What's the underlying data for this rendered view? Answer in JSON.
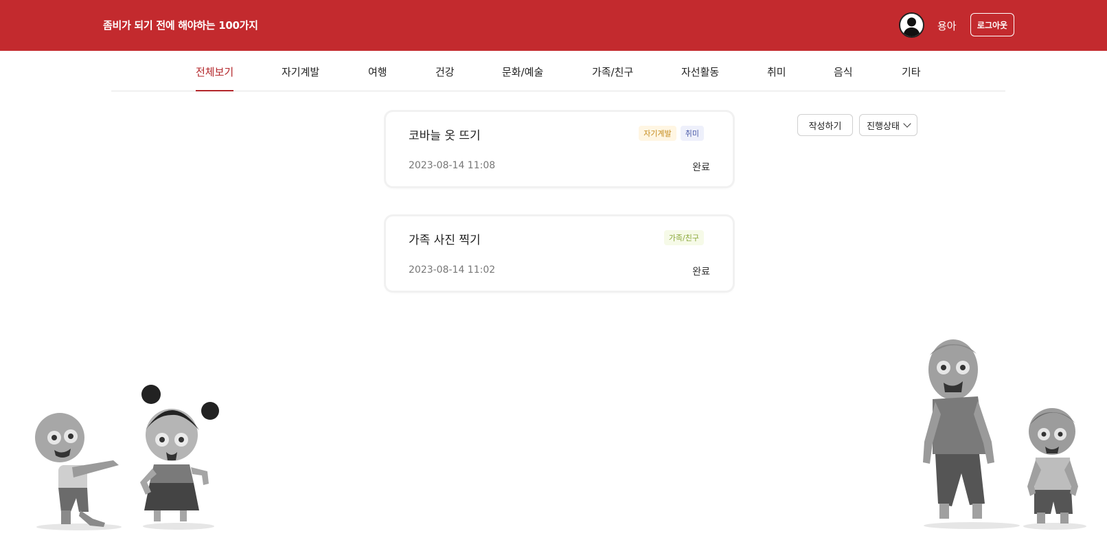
{
  "header": {
    "site_title": "좀비가 되기 전에 해야하는 100가지",
    "username": "용아",
    "logout_label": "로그아웃"
  },
  "categories": [
    {
      "label": "전체보기",
      "active": true
    },
    {
      "label": "자기계발",
      "active": false
    },
    {
      "label": "여행",
      "active": false
    },
    {
      "label": "건강",
      "active": false
    },
    {
      "label": "문화/예술",
      "active": false
    },
    {
      "label": "가족/친구",
      "active": false
    },
    {
      "label": "자선활동",
      "active": false
    },
    {
      "label": "취미",
      "active": false
    },
    {
      "label": "음식",
      "active": false
    },
    {
      "label": "기타",
      "active": false
    }
  ],
  "toolbar": {
    "write_label": "작성하기",
    "status_label": "진행상태"
  },
  "posts": [
    {
      "title": "코바늘 옷 뜨기",
      "tags": [
        "자기계발",
        "취미"
      ],
      "date": "2023-08-14 11:08",
      "status": "완료"
    },
    {
      "title": "가족 사진 찍기",
      "tags": [
        "가족/친구"
      ],
      "date": "2023-08-14 11:02",
      "status": "완료"
    }
  ],
  "colors": {
    "brand": "#c32a2e",
    "active_tab": "#b3262a"
  },
  "icons": {
    "avatar": "user-silhouette-icon",
    "status_dropdown": "chevron-down-icon",
    "illustrations": [
      "zombie-boy-illustration",
      "zombie-girl-illustration",
      "zombie-man-illustration",
      "zombie-kid-illustration"
    ]
  }
}
